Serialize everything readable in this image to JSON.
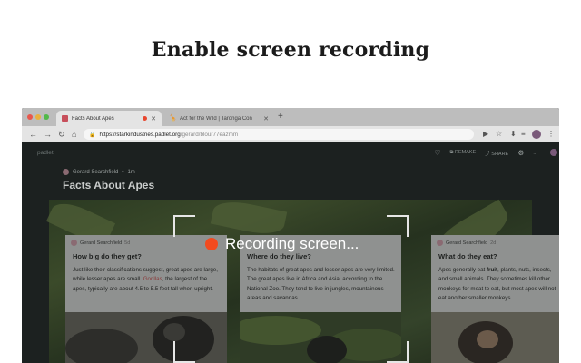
{
  "headline": "Enable screen recording",
  "browser": {
    "tabs": [
      {
        "label": "Facts About Apes",
        "recording": true
      },
      {
        "label": "Act for the Wild | Taronga Con"
      }
    ],
    "new_tab_label": "+",
    "url_host": "https://starkindustries.padlet.org",
    "url_path": "/gerard/blour77eazmm"
  },
  "padlet": {
    "logo": "padlet",
    "actions": {
      "remake": "REMAKE",
      "share": "SHARE",
      "more": "..."
    },
    "author": "Gerard Searchfield",
    "time": "1m",
    "title": "Facts About Apes"
  },
  "cards": [
    {
      "author": "Gerard Searchfield",
      "time": "5d",
      "title": "How big do they get?",
      "body_before": "Just like their classifications suggest, great apes are large, while lesser apes are small. ",
      "body_highlight": "Gorillas",
      "body_after": ", the largest of the apes, typically are about 4.5 to 5.5 feet tall when upright."
    },
    {
      "author": "",
      "time": "",
      "title": "Where do they live?",
      "body_before": "The habitats of great apes and lesser apes are very limited. The great apes live in Africa and Asia, according to the National Zoo. They tend to live in jungles, mountainous areas and savannas.",
      "body_highlight": "",
      "body_after": ""
    },
    {
      "author": "Gerard Searchfield",
      "time": "2d",
      "title": "What do they eat?",
      "body_before": "Apes generally eat ",
      "body_highlight": "fruit",
      "body_after": ", plants, nuts, insects, and small animals. They sometimes kill other monkeys for meat to eat, but most apes will not eat another smaller monkeys."
    }
  ],
  "recording": {
    "label": "Recording screen..."
  },
  "colors": {
    "record_accent": "#f24a1f",
    "tab_record": "#e8472f"
  }
}
